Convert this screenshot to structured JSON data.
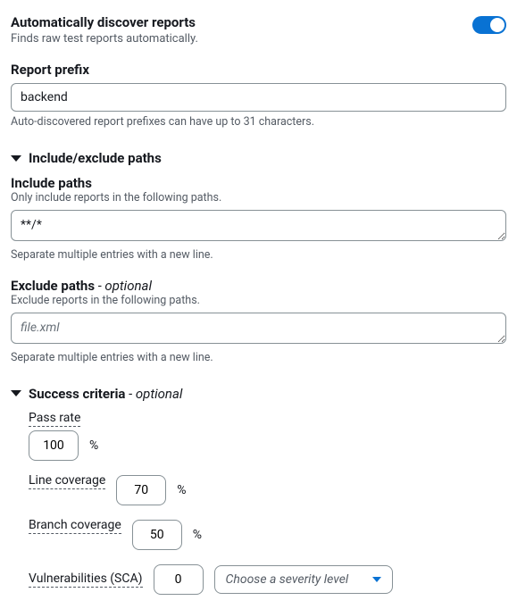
{
  "autoDiscover": {
    "title": "Automatically discover reports",
    "desc": "Finds raw test reports automatically.",
    "enabled": true
  },
  "reportPrefix": {
    "label": "Report prefix",
    "value": "backend",
    "helper": "Auto-discovered report prefixes can have up to 31 characters."
  },
  "paths": {
    "heading": "Include/exclude paths",
    "include": {
      "label": "Include paths",
      "desc": "Only include reports in the following paths.",
      "value": "**/*",
      "helper": "Separate multiple entries with a new line."
    },
    "exclude": {
      "label": "Exclude paths",
      "optional": " - optional",
      "desc": "Exclude reports in the following paths.",
      "value": "",
      "placeholder": "file.xml",
      "helper": "Separate multiple entries with a new line."
    }
  },
  "criteria": {
    "heading": "Success criteria",
    "optional": " - optional",
    "passRate": {
      "label": "Pass rate",
      "value": "100",
      "unit": "%"
    },
    "lineCoverage": {
      "label": "Line coverage",
      "value": "70",
      "unit": "%"
    },
    "branchCoverage": {
      "label": "Branch coverage",
      "value": "50",
      "unit": "%"
    },
    "vulnerabilities": {
      "label": "Vulnerabilities (SCA)",
      "value": "0",
      "selectPlaceholder": "Choose a severity level"
    }
  }
}
